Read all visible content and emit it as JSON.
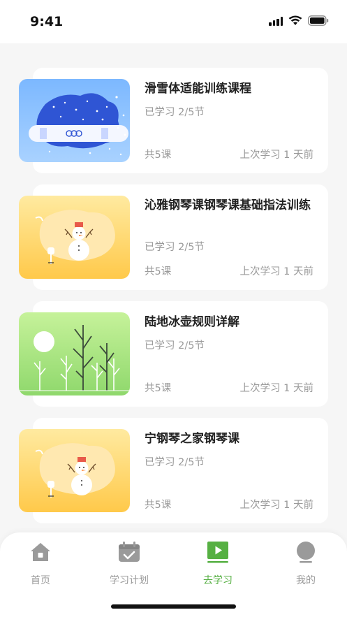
{
  "status_bar": {
    "time": "9:41"
  },
  "courses": [
    {
      "title": "滑雪体适能训练课程",
      "progress": "已学习 2/5节",
      "count": "共5课",
      "last": "上次学习 1 天前",
      "thumb": "snowboard"
    },
    {
      "title": "沁雅钢琴课钢琴课基础指法训练",
      "progress": "已学习 2/5节",
      "count": "共5课",
      "last": "上次学习 1 天前",
      "thumb": "snowman"
    },
    {
      "title": "陆地冰壶规则详解",
      "progress": "已学习 2/5节",
      "count": "共5课",
      "last": "上次学习 1 天前",
      "thumb": "forest"
    },
    {
      "title": "宁钢琴之家钢琴课",
      "progress": "已学习 2/5节",
      "count": "共5课",
      "last": "上次学习 1 天前",
      "thumb": "snowman"
    }
  ],
  "tabs": [
    {
      "label": "首页",
      "icon": "home-icon"
    },
    {
      "label": "学习计划",
      "icon": "calendar-check-icon"
    },
    {
      "label": "去学习",
      "icon": "play-icon",
      "active": true
    },
    {
      "label": "我的",
      "icon": "user-icon"
    }
  ],
  "colors": {
    "accent": "#56b043",
    "inactive": "#9a9a9a",
    "background": "#f6f6f6"
  }
}
